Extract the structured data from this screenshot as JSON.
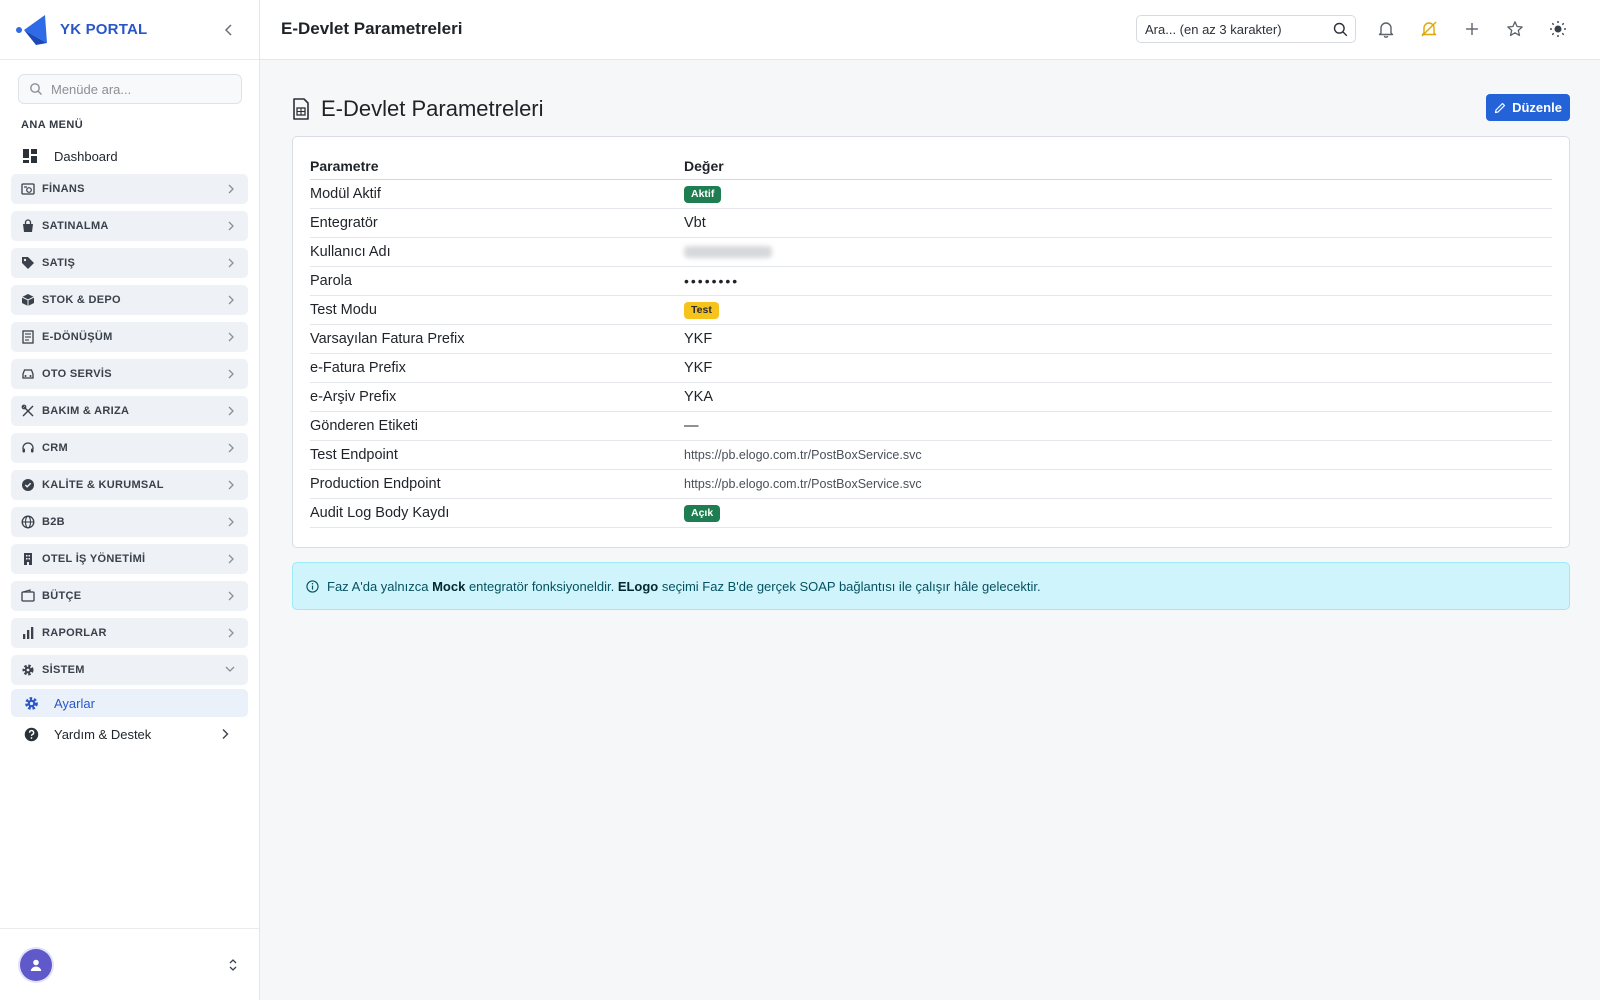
{
  "brand": {
    "name": "YK PORTAL"
  },
  "sidebar": {
    "search_placeholder": "Menüde ara...",
    "section_label": "ANA MENÜ",
    "dashboard": "Dashboard",
    "groups": [
      {
        "label": "FİNANS",
        "icon": "finance-icon"
      },
      {
        "label": "SATINALMA",
        "icon": "shopping-bag-icon"
      },
      {
        "label": "SATIŞ",
        "icon": "tag-icon"
      },
      {
        "label": "STOK & DEPO",
        "icon": "box-icon"
      },
      {
        "label": "E-DÖNÜŞÜM",
        "icon": "receipt-icon"
      },
      {
        "label": "OTO SERVİS",
        "icon": "car-icon"
      },
      {
        "label": "BAKIM & ARIZA",
        "icon": "tools-icon"
      },
      {
        "label": "CRM",
        "icon": "headset-icon"
      },
      {
        "label": "KALİTE & KURUMSAL",
        "icon": "badge-check-icon"
      },
      {
        "label": "B2B",
        "icon": "globe-icon"
      },
      {
        "label": "OTEL İŞ YÖNETİMİ",
        "icon": "building-icon"
      },
      {
        "label": "BÜTÇE",
        "icon": "wallet-icon"
      },
      {
        "label": "RAPORLAR",
        "icon": "bar-chart-icon"
      },
      {
        "label": "SİSTEM",
        "icon": "gear-icon"
      }
    ],
    "active_sub": "Ayarlar",
    "help": "Yardım & Destek"
  },
  "header": {
    "title": "E-Devlet Parametreleri",
    "search_placeholder": "Ara... (en az 3 karakter)"
  },
  "page": {
    "title": "E-Devlet Parametreleri",
    "edit_label": "Düzenle",
    "table": {
      "col_param": "Parametre",
      "col_value": "Değer",
      "rows": [
        {
          "param": "Modül Aktif",
          "value": "Aktif",
          "kind": "badge-green"
        },
        {
          "param": "Entegratör",
          "value": "Vbt",
          "kind": "text"
        },
        {
          "param": "Kullanıcı Adı",
          "value": "",
          "kind": "blurred"
        },
        {
          "param": "Parola",
          "value": "••••••••",
          "kind": "password"
        },
        {
          "param": "Test Modu",
          "value": "Test",
          "kind": "badge-yellow"
        },
        {
          "param": "Varsayılan Fatura Prefix",
          "value": "YKF",
          "kind": "text"
        },
        {
          "param": "e-Fatura Prefix",
          "value": "YKF",
          "kind": "text"
        },
        {
          "param": "e-Arşiv Prefix",
          "value": "YKA",
          "kind": "text"
        },
        {
          "param": "Gönderen Etiketi",
          "value": "—",
          "kind": "text"
        },
        {
          "param": "Test Endpoint",
          "value": "https://pb.elogo.com.tr/PostBoxService.svc",
          "kind": "url"
        },
        {
          "param": "Production Endpoint",
          "value": "https://pb.elogo.com.tr/PostBoxService.svc",
          "kind": "url"
        },
        {
          "param": "Audit Log Body Kaydı",
          "value": "Açık",
          "kind": "badge-green"
        }
      ]
    },
    "alert": {
      "part1": "Faz A'da yalnızca ",
      "bold1": "Mock",
      "part2": " entegratör fonksiyoneldir. ",
      "bold2": "ELogo",
      "part3": " seçimi Faz B'de gerçek SOAP bağlantısı ile çalışır hâle gelecektir."
    }
  },
  "colors": {
    "primary": "#2462d8",
    "brand": "#2957c8",
    "success": "#1e7e52",
    "warning": "#f6c31c",
    "info_bg": "#cff4fc"
  }
}
